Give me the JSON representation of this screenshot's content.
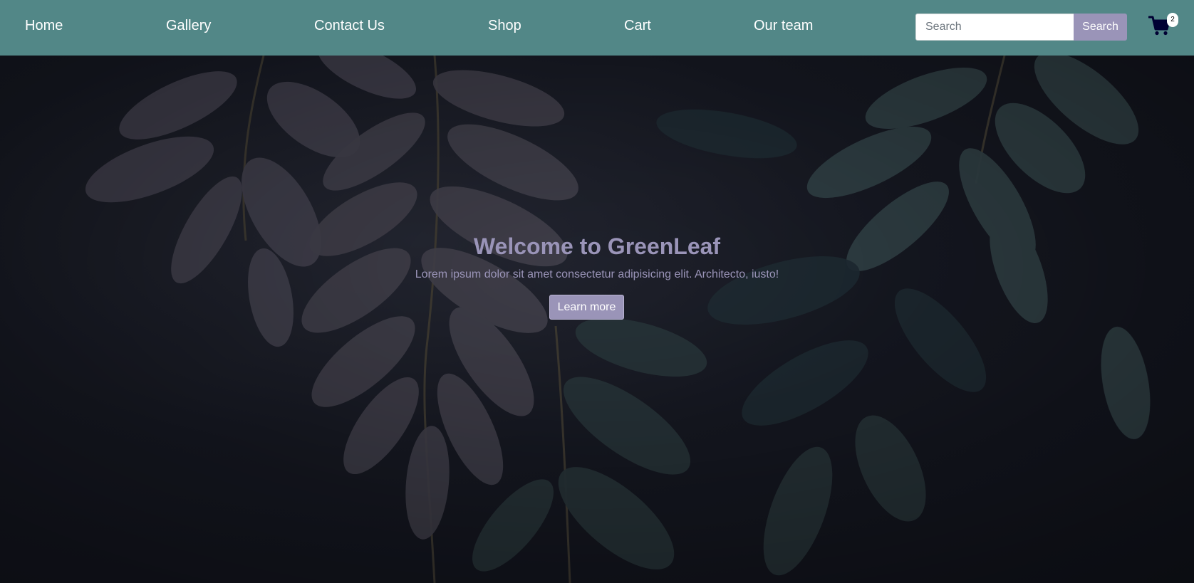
{
  "nav": {
    "links": [
      "Home",
      "Gallery",
      "Contact Us",
      "Shop",
      "Cart",
      "Our team"
    ]
  },
  "search": {
    "placeholder": "Search",
    "button_label": "Search"
  },
  "cart": {
    "icon": "shopping-cart-icon",
    "count": "2"
  },
  "hero": {
    "title_prefix": "Welcome to ",
    "title_brand": "GreenLeaf",
    "text": "Lorem ipsum dolor sit amet consectetur adipisicing elit. Architecto, iusto!",
    "button_label": "Learn more",
    "background": "dark-leaves-photo"
  },
  "colors": {
    "navbar": "#528787",
    "accent": "#9a94b8",
    "hero_bg": "#141821"
  }
}
